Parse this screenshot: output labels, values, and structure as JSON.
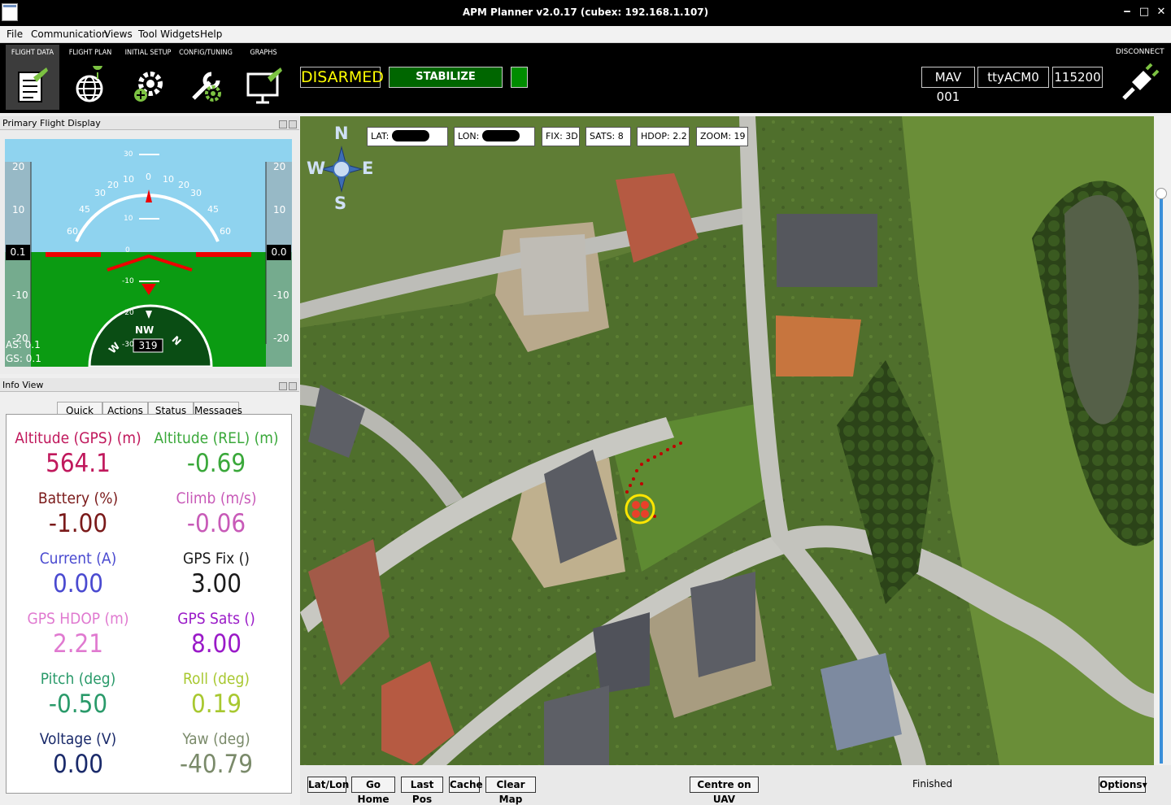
{
  "window": {
    "title": "APM Planner v2.0.17 (cubex: 192.168.1.107)"
  },
  "menu": [
    "File",
    "Communication",
    "Views",
    "Tool Widgets",
    "Help"
  ],
  "toolbar": {
    "tabs": [
      "FLIGHT DATA",
      "FLIGHT PLAN",
      "INITIAL SETUP",
      "CONFIG/TUNING",
      "GRAPHS"
    ],
    "arm_state": "DISARMED",
    "mode": "STABILIZE",
    "mav": "MAV 001",
    "port": "ttyACM0",
    "baud": "115200",
    "disconnect": "DISCONNECT"
  },
  "pfd_panel": {
    "title": "Primary Flight Display",
    "left_tape": {
      "top": "20",
      "upper": "10",
      "value": "0.1",
      "lower": "-10",
      "bottom": "-20"
    },
    "right_tape": {
      "top": "20",
      "upper": "10",
      "value": "0.0",
      "lower": "-10",
      "bottom": "-20"
    },
    "roll_ticks": {
      "l60": "60",
      "l45": "45",
      "l30": "30",
      "l20": "20",
      "l10": "10",
      "c0": "0",
      "r10": "10",
      "r20": "20",
      "r30": "30",
      "r45": "45",
      "r60": "60"
    },
    "pitch_labels": {
      "p30": "30",
      "p10": "10",
      "p0": "0",
      "m10": "-10",
      "m20": "-20",
      "m30": "-30"
    },
    "heading_dir": "NW",
    "heading_value": "319",
    "compass_w": "W",
    "compass_n": "N",
    "airspeed": "AS: 0.1",
    "groundspeed": "GS: 0.1"
  },
  "info_panel": {
    "title": "Info View",
    "tabs": [
      "Quick",
      "Actions",
      "Status",
      "Messages"
    ],
    "metrics": [
      {
        "label": "Altitude (GPS) (m)",
        "value": "564.1",
        "color": "#c0185c"
      },
      {
        "label": "Altitude (REL) (m)",
        "value": "-0.69",
        "color": "#3aa83a"
      },
      {
        "label": "Battery (%)",
        "value": "-1.00",
        "color": "#7a1a1a"
      },
      {
        "label": "Climb (m/s)",
        "value": "-0.06",
        "color": "#c85ab8"
      },
      {
        "label": "Current (A)",
        "value": "0.00",
        "color": "#4a4ad0"
      },
      {
        "label": "GPS Fix ()",
        "value": "3.00",
        "color": "#1a1a1a"
      },
      {
        "label": "GPS HDOP (m)",
        "value": "2.21",
        "color": "#e07ad0"
      },
      {
        "label": "GPS Sats ()",
        "value": "8.00",
        "color": "#9a1ac8"
      },
      {
        "label": "Pitch (deg)",
        "value": "-0.50",
        "color": "#2a9a6a"
      },
      {
        "label": "Roll (deg)",
        "value": "0.19",
        "color": "#a8c830"
      },
      {
        "label": "Voltage (V)",
        "value": "0.00",
        "color": "#1a2a6a"
      },
      {
        "label": "Yaw (deg)",
        "value": "-40.79",
        "color": "#7a8a6a"
      }
    ]
  },
  "map": {
    "compass": {
      "n": "N",
      "s": "S",
      "e": "E",
      "w": "W"
    },
    "lat_label": "LAT:",
    "lon_label": "LON:",
    "fix": "FIX: 3D",
    "sats": "SATS: 8",
    "hdop": "HDOP: 2.2",
    "zoom": "ZOOM: 19"
  },
  "bottom": {
    "buttons": [
      "Lat/Lon",
      "Go Home",
      "Last Pos",
      "Cache",
      "Clear Map"
    ],
    "centre": "Centre on UAV",
    "status": "Finished",
    "options": "Options"
  }
}
